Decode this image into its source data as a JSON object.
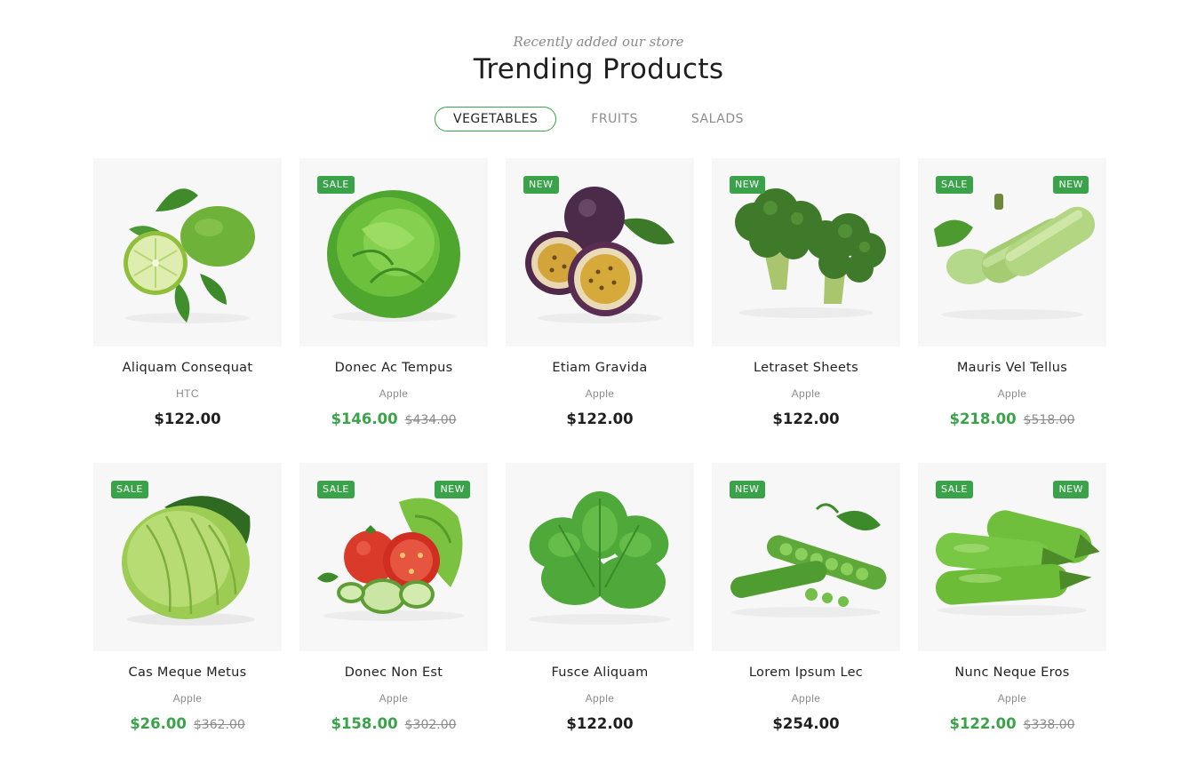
{
  "header": {
    "subtitle": "Recently added our store",
    "title": "Trending Products"
  },
  "tabs": [
    {
      "label": "VEGETABLES",
      "active": true
    },
    {
      "label": "FRUITS",
      "active": false
    },
    {
      "label": "SALADS",
      "active": false
    }
  ],
  "colors": {
    "accent": "#3aa34a",
    "thumb_bg": "#f7f7f7"
  },
  "products": [
    {
      "name": "Aliquam Consequat",
      "brand": "HTC",
      "price": "$122.00",
      "old_price": "",
      "badges": [],
      "image": "lime-icon"
    },
    {
      "name": "Donec Ac Tempus",
      "brand": "Apple",
      "price": "$146.00",
      "old_price": "$434.00",
      "badges": [
        "SALE"
      ],
      "image": "lettuce-icon"
    },
    {
      "name": "Etiam Gravida",
      "brand": "Apple",
      "price": "$122.00",
      "old_price": "",
      "badges": [
        "NEW"
      ],
      "image": "passion-fruit-icon"
    },
    {
      "name": "Letraset Sheets",
      "brand": "Apple",
      "price": "$122.00",
      "old_price": "",
      "badges": [
        "NEW"
      ],
      "image": "broccoli-icon"
    },
    {
      "name": "Mauris Vel Tellus",
      "brand": "Apple",
      "price": "$218.00",
      "old_price": "$518.00",
      "badges": [
        "SALE",
        "NEW"
      ],
      "image": "zucchini-icon"
    },
    {
      "name": "Cas Meque Metus",
      "brand": "Apple",
      "price": "$26.00",
      "old_price": "$362.00",
      "badges": [
        "SALE"
      ],
      "image": "cabbage-icon"
    },
    {
      "name": "Donec Non Est",
      "brand": "Apple",
      "price": "$158.00",
      "old_price": "$302.00",
      "badges": [
        "SALE",
        "NEW"
      ],
      "image": "tomato-cucumber-icon"
    },
    {
      "name": "Fusce Aliquam",
      "brand": "Apple",
      "price": "$122.00",
      "old_price": "",
      "badges": [],
      "image": "spinach-icon"
    },
    {
      "name": "Lorem Ipsum Lec",
      "brand": "Apple",
      "price": "$254.00",
      "old_price": "",
      "badges": [
        "NEW"
      ],
      "image": "peas-icon"
    },
    {
      "name": "Nunc Neque Eros",
      "brand": "Apple",
      "price": "$122.00",
      "old_price": "$338.00",
      "badges": [
        "SALE",
        "NEW"
      ],
      "image": "green-eggplant-icon"
    }
  ]
}
